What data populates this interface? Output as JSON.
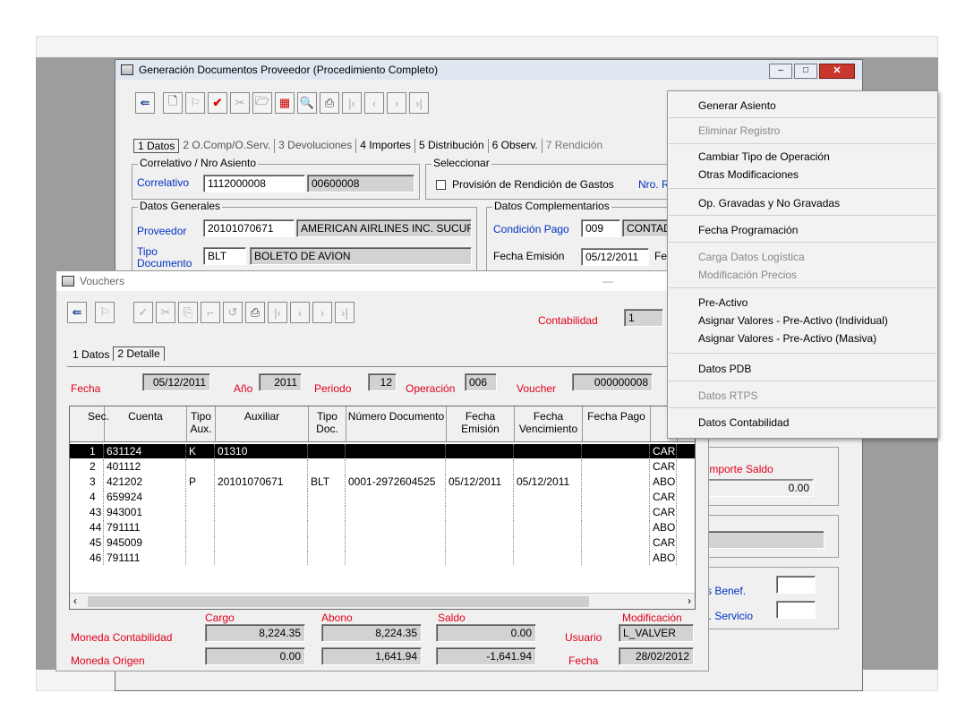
{
  "main_window": {
    "title": "Generación Documentos Proveedor  (Procedimiento Completo)",
    "tabs": [
      "1 Datos",
      "2 O.Comp/O.Serv.",
      "3 Devoluciones",
      "4 Importes",
      "5 Distribución",
      "6 Observ.",
      "7 Rendición"
    ],
    "correlativo_group": "Correlativo / Nro Asiento",
    "correlativo_label": "Correlativo",
    "correlativo_value": "1112000008",
    "asiento_value": "00600008",
    "seleccionar_group": "Seleccionar",
    "provision_label": "Provisión de Rendición de Gastos",
    "nro_label": "Nro. R",
    "datos_generales_group": "Datos Generales",
    "proveedor_label": "Proveedor",
    "proveedor_code": "20101070671",
    "proveedor_name": "AMERICAN AIRLINES INC. SUCUR",
    "tipo_doc_label": "Tipo Documento",
    "tipo_doc_code": "BLT",
    "tipo_doc_name": "BOLETO DE AVION",
    "datos_compl_group": "Datos Complementarios",
    "condicion_label": "Condición Pago",
    "condicion_code": "009",
    "condicion_name": "CONTAD",
    "fecha_emision_label": "Fecha Emisión",
    "fecha_emision_value": "05/12/2011",
    "fe_label": "Fe",
    "importe_saldo_label": "Importe Saldo",
    "importe_saldo_value": "0.00",
    "benef_label": "s Benef.",
    "servicio_label": "l. Servicio"
  },
  "vouchers": {
    "title": "Vouchers",
    "contabilidad_label": "Contabilidad",
    "contabilidad_value": "1",
    "tabs": [
      "1 Datos",
      "2 Detalle"
    ],
    "fecha_label": "Fecha",
    "fecha_value": "05/12/2011",
    "anio_label": "Año",
    "anio_value": "2011",
    "periodo_label": "Periodo",
    "periodo_value": "12",
    "operacion_label": "Operación",
    "operacion_value": "006",
    "voucher_label": "Voucher",
    "voucher_value": "000000008",
    "columns": [
      "Sec.",
      "Cuenta",
      "Tipo Aux.",
      "Auxiliar",
      "Tipo Doc.",
      "Número Documento",
      "Fecha Emisión",
      "Fecha Vencimiento",
      "Fecha Pago",
      ""
    ],
    "rows": [
      [
        "1",
        "631124",
        "K",
        "01310",
        "",
        "",
        "",
        "",
        "",
        "CAR"
      ],
      [
        "2",
        "401112",
        "",
        "",
        "",
        "",
        "",
        "",
        "",
        "CAR"
      ],
      [
        "3",
        "421202",
        "P",
        "20101070671",
        "BLT",
        "0001-2972604525",
        "05/12/2011",
        "05/12/2011",
        "",
        "ABO"
      ],
      [
        "4",
        "659924",
        "",
        "",
        "",
        "",
        "",
        "",
        "",
        "CAR"
      ],
      [
        "43",
        "943001",
        "",
        "",
        "",
        "",
        "",
        "",
        "",
        "CAR"
      ],
      [
        "44",
        "791111",
        "",
        "",
        "",
        "",
        "",
        "",
        "",
        "ABO"
      ],
      [
        "45",
        "945009",
        "",
        "",
        "",
        "",
        "",
        "",
        "",
        "CAR"
      ],
      [
        "46",
        "791111",
        "",
        "",
        "",
        "",
        "",
        "",
        "",
        "ABO"
      ]
    ],
    "totals": {
      "cargo_label": "Cargo",
      "abono_label": "Abono",
      "saldo_label": "Saldo",
      "modificacion_label": "Modificación",
      "moneda_contabilidad_label": "Moneda Contabilidad",
      "moneda_origen_label": "Moneda Origen",
      "mc_cargo": "8,224.35",
      "mc_abono": "8,224.35",
      "mc_saldo": "0.00",
      "mo_cargo": "0.00",
      "mo_abono": "1,641.94",
      "mo_saldo": "-1,641.94",
      "usuario_label": "Usuario",
      "usuario_value": "L_VALVER",
      "fecha_label": "Fecha",
      "fecha_value": "28/02/2012"
    }
  },
  "context_menu": {
    "items": [
      {
        "label": "Generar Asiento",
        "enabled": true
      },
      {
        "label": "Eliminar Registro",
        "enabled": false
      },
      {
        "label": "Cambiar Tipo de Operación",
        "enabled": true
      },
      {
        "label": "Otras Modificaciones",
        "enabled": true
      },
      {
        "label": "Op. Gravadas y No Gravadas",
        "enabled": true
      },
      {
        "label": "Fecha Programación",
        "enabled": true
      },
      {
        "label": "Carga Datos Logística",
        "enabled": false
      },
      {
        "label": "Modificación Precios",
        "enabled": false
      },
      {
        "label": "Pre-Activo",
        "enabled": true
      },
      {
        "label": "Asignar Valores - Pre-Activo (Individual)",
        "enabled": true
      },
      {
        "label": "Asignar Valores - Pre-Activo (Masiva)",
        "enabled": true
      },
      {
        "label": "Datos PDB",
        "enabled": true
      },
      {
        "label": "Datos RTPS",
        "enabled": false
      },
      {
        "label": "Datos Contabilidad",
        "enabled": true
      }
    ]
  },
  "colors": {
    "label_red": "#e0001b",
    "label_blue": "#0030c0",
    "close_red": "#c9372c"
  }
}
